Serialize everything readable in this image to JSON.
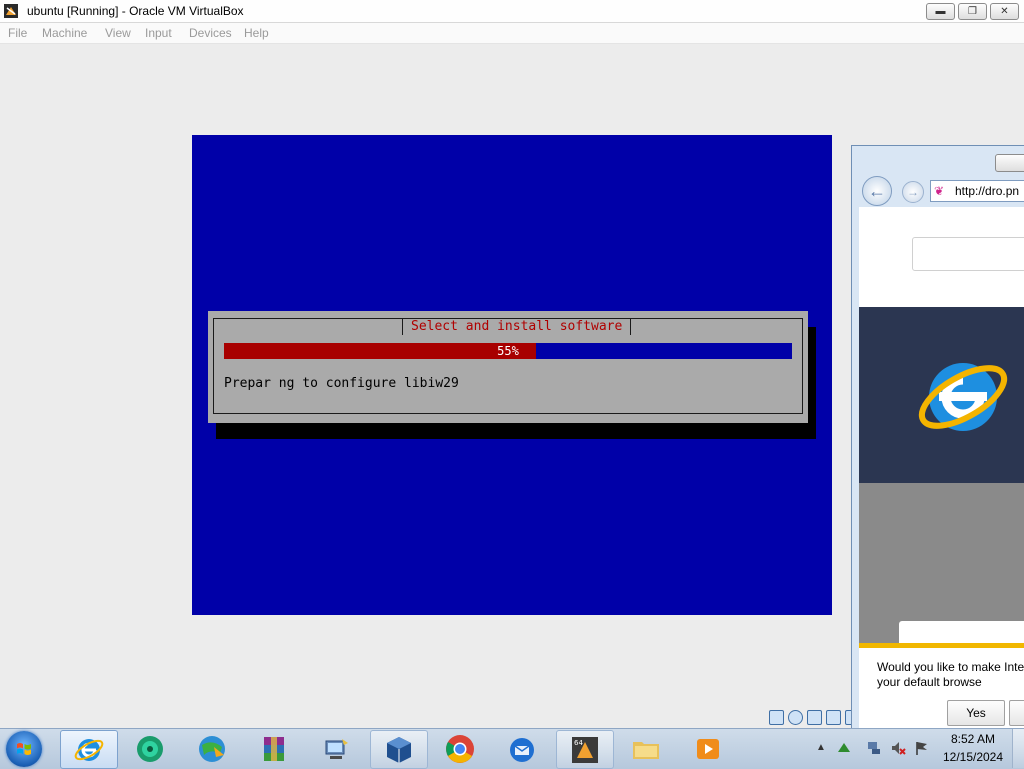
{
  "window": {
    "title": "ubuntu [Running] - Oracle VM VirtualBox",
    "controls": [
      "minimize",
      "restore",
      "close"
    ]
  },
  "menu": {
    "items": [
      "File",
      "Machine",
      "View",
      "Input",
      "Devices",
      "Help"
    ]
  },
  "installer": {
    "dialog_title": "Select and install software",
    "progress_percent": 55,
    "progress_label": "55%",
    "message": "Prepar ng to configure libiw29",
    "colors": {
      "screen": "#0000a8",
      "dialog": "#aaaaaa",
      "title": "#b00000",
      "progress_fill": "#a80000"
    }
  },
  "vm_statusbar": {
    "icons": [
      "hard-disk-icon",
      "optical-drive-icon",
      "network-icon",
      "usb-icon",
      "shared-folder-icon"
    ]
  },
  "ie": {
    "url": "http://dro.pn",
    "notification": {
      "text": "Would you like to make Inte Explorer your default browse",
      "yes_label": "Yes"
    }
  },
  "taskbar": {
    "apps": [
      "internet-explorer",
      "media-center",
      "browser-globe",
      "winrar",
      "network-tool",
      "virtualbox",
      "chrome",
      "thunderbird",
      "system-64bit-app",
      "file-explorer",
      "media-player"
    ],
    "tray": {
      "time": "8:52 AM",
      "date": "12/15/2024",
      "icons": [
        "show-hidden-icons",
        "app-tray-icon",
        "network-icon",
        "volume-muted-icon",
        "action-center-flag-icon"
      ]
    }
  }
}
